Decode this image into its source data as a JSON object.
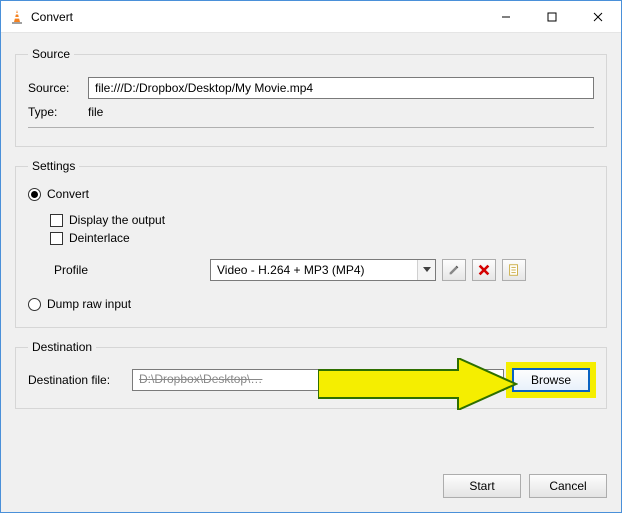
{
  "window": {
    "title": "Convert"
  },
  "source": {
    "legend": "Source",
    "source_label": "Source:",
    "source_value": "file:///D:/Dropbox/Desktop/My Movie.mp4",
    "type_label": "Type:",
    "type_value": "file"
  },
  "settings": {
    "legend": "Settings",
    "convert_label": "Convert",
    "display_output_label": "Display the output",
    "deinterlace_label": "Deinterlace",
    "profile_label": "Profile",
    "profile_value": "Video - H.264 + MP3 (MP4)",
    "dump_label": "Dump raw input"
  },
  "destination": {
    "legend": "Destination",
    "file_label": "Destination file:",
    "file_value": "D:\\Dropbox\\Desktop\\…",
    "browse_label": "Browse"
  },
  "footer": {
    "start_label": "Start",
    "cancel_label": "Cancel"
  }
}
